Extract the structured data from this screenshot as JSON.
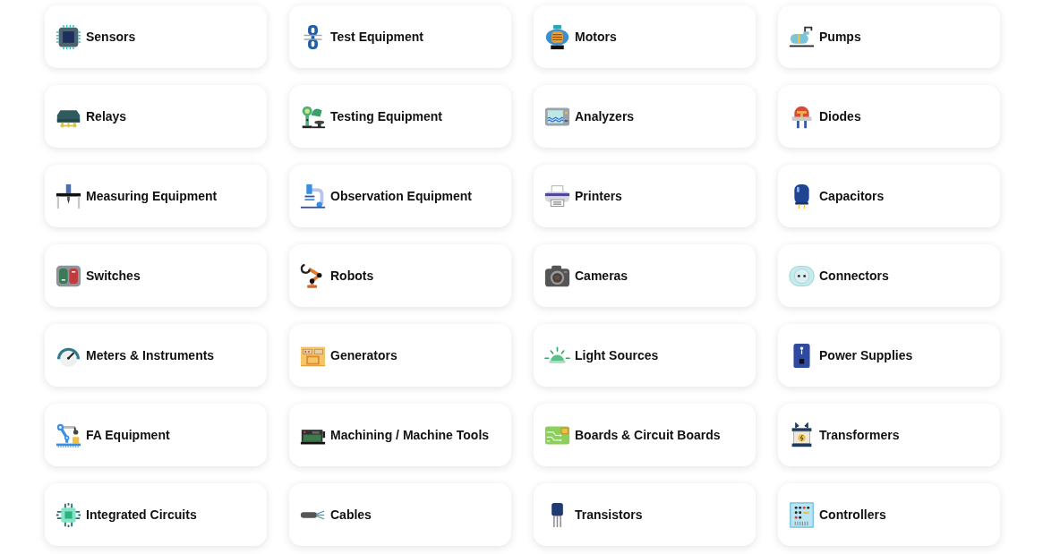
{
  "categories": [
    {
      "label": "Sensors"
    },
    {
      "label": "Test Equipment"
    },
    {
      "label": "Motors"
    },
    {
      "label": "Pumps"
    },
    {
      "label": "Relays"
    },
    {
      "label": "Testing Equipment"
    },
    {
      "label": "Analyzers"
    },
    {
      "label": "Diodes"
    },
    {
      "label": "Measuring Equipment"
    },
    {
      "label": "Observation Equipment"
    },
    {
      "label": "Printers"
    },
    {
      "label": "Capacitors"
    },
    {
      "label": "Switches"
    },
    {
      "label": "Robots"
    },
    {
      "label": "Cameras"
    },
    {
      "label": "Connectors"
    },
    {
      "label": "Meters & Instruments"
    },
    {
      "label": "Generators"
    },
    {
      "label": "Light Sources"
    },
    {
      "label": "Power Supplies"
    },
    {
      "label": "FA Equipment"
    },
    {
      "label": "Machining / Machine Tools"
    },
    {
      "label": "Boards & Circuit Boards"
    },
    {
      "label": "Transformers"
    },
    {
      "label": "Integrated Circuits"
    },
    {
      "label": "Cables"
    },
    {
      "label": "Transistors"
    },
    {
      "label": "Controllers"
    }
  ]
}
